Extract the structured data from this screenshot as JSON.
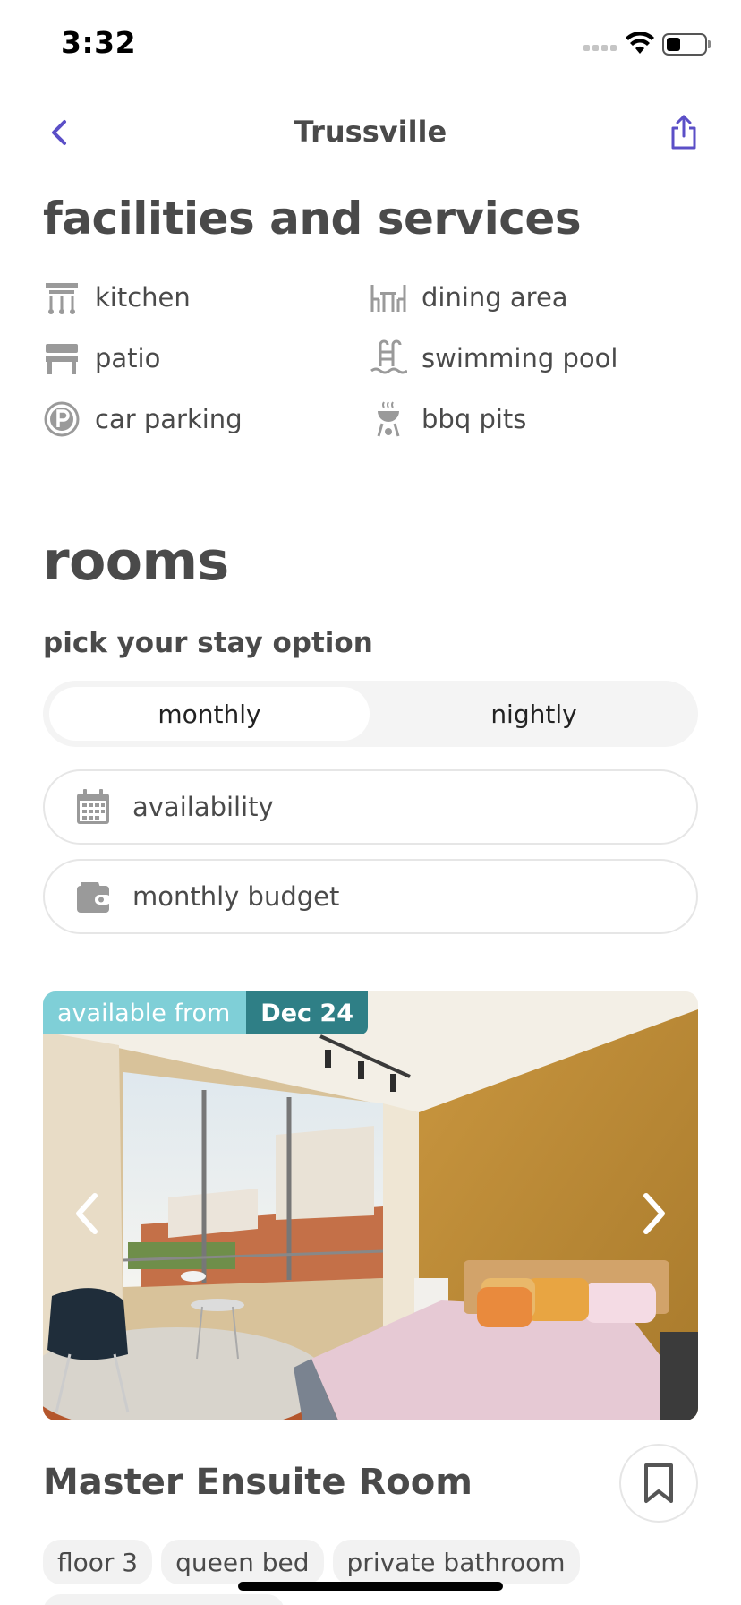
{
  "status_bar": {
    "time": "3:32"
  },
  "nav": {
    "title": "Trussville"
  },
  "facilities": {
    "title": "facilities and services",
    "items": [
      {
        "label": "kitchen",
        "icon": "kitchen-icon"
      },
      {
        "label": "dining area",
        "icon": "dining-icon"
      },
      {
        "label": "patio",
        "icon": "patio-bench-icon"
      },
      {
        "label": "swimming pool",
        "icon": "pool-ladder-icon"
      },
      {
        "label": "car parking",
        "icon": "parking-icon"
      },
      {
        "label": "bbq pits",
        "icon": "bbq-grill-icon"
      }
    ]
  },
  "rooms": {
    "title": "rooms",
    "stay_label": "pick your stay option",
    "stay_options": {
      "monthly": "monthly",
      "nightly": "nightly",
      "selected": "monthly"
    },
    "filters": {
      "availability": "availability",
      "budget": "monthly budget"
    }
  },
  "room_card": {
    "badge_label": "available from",
    "badge_date": "Dec 24",
    "name": "Master Ensuite Room",
    "tags": [
      "floor 3",
      "queen bed",
      "private bathroom"
    ]
  },
  "colors": {
    "accent": "#5b4fc7",
    "badge_light": "#7fcfd7",
    "badge_dark": "#2f7f86",
    "text": "#4a4a4a",
    "icon_grey": "#9a9a9a"
  }
}
